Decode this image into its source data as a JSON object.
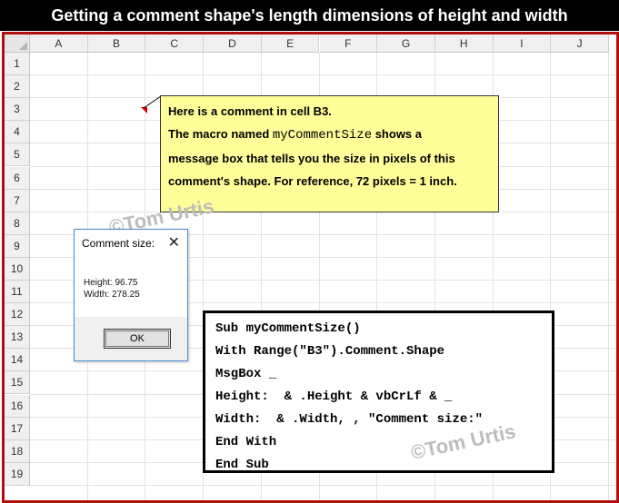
{
  "banner": {
    "title": "Getting a comment shape's length dimensions of height and width"
  },
  "sheet": {
    "columns": [
      "A",
      "B",
      "C",
      "D",
      "E",
      "F",
      "G",
      "H",
      "I",
      "J"
    ],
    "rows": [
      "1",
      "2",
      "3",
      "4",
      "5",
      "6",
      "7",
      "8",
      "9",
      "10",
      "11",
      "12",
      "13",
      "14",
      "15",
      "16",
      "17",
      "18",
      "19"
    ]
  },
  "comment": {
    "line1": "Here is a comment in cell B3.",
    "line2_prefix": "The macro named ",
    "macro_name": "myCommentSize",
    "line2_suffix": " shows a",
    "line3": "message box that tells you the size in pixels of this",
    "line4": "comment's shape. For reference, 72 pixels = 1 inch."
  },
  "dialog": {
    "title": "Comment size:",
    "height_line": "Height: 96.75",
    "width_line": "Width: 278.25",
    "ok_label": "OK"
  },
  "code": {
    "lines": [
      "Sub myCommentSize()",
      "With Range(\"B3\").Comment.Shape",
      "MsgBox _",
      "Height:  & .Height & vbCrLf & _",
      "Width:  & .Width, , \"Comment size:\"",
      "End With",
      "End Sub"
    ]
  },
  "watermark": {
    "text": "©Tom Urtis"
  },
  "colors": {
    "frame": "#b30d0d",
    "comment_fill": "#ffff99",
    "banner": "#000000"
  }
}
